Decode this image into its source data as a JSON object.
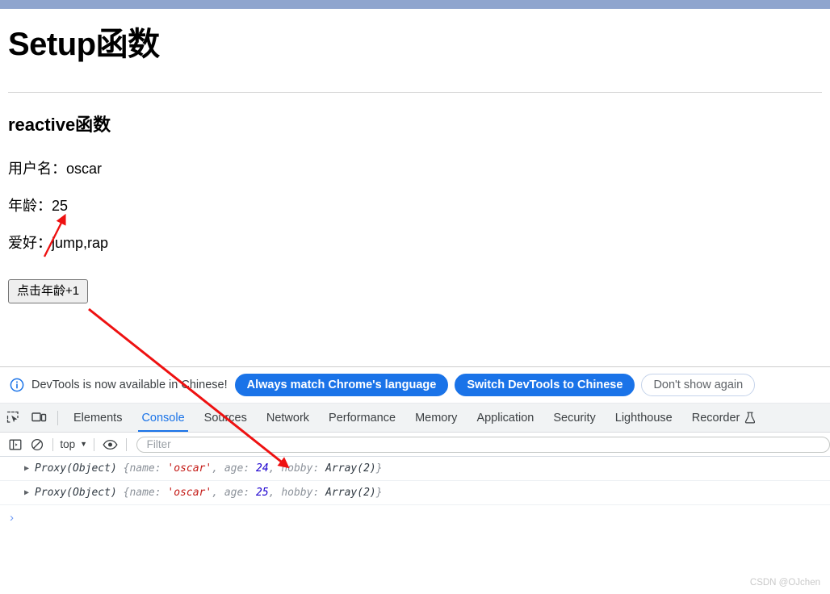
{
  "page": {
    "title": "Setup函数",
    "subtitle": "reactive函数",
    "fields": [
      {
        "label": "用户名：",
        "value": "oscar",
        "text": "用户名：oscar"
      },
      {
        "label": "年龄：",
        "value": "25",
        "text": "年龄：25"
      },
      {
        "label": "爱好：",
        "value": "jump,rap",
        "text": "爱好：jump,rap"
      }
    ],
    "button_label": "点击年龄+1"
  },
  "devtools": {
    "banner": {
      "icon": "info-circle-icon",
      "message": "DevTools is now available in Chinese!",
      "primary_action": "Always match Chrome's language",
      "secondary_action": "Switch DevTools to Chinese",
      "dismiss_action": "Don't show again"
    },
    "toolbar_icons": {
      "inspect": "inspect-element-icon",
      "device": "device-toolbar-icon"
    },
    "tabs": [
      {
        "label": "Elements",
        "active": false
      },
      {
        "label": "Console",
        "active": true
      },
      {
        "label": "Sources",
        "active": false
      },
      {
        "label": "Network",
        "active": false
      },
      {
        "label": "Performance",
        "active": false
      },
      {
        "label": "Memory",
        "active": false
      },
      {
        "label": "Application",
        "active": false
      },
      {
        "label": "Security",
        "active": false
      },
      {
        "label": "Lighthouse",
        "active": false
      },
      {
        "label": "Recorder",
        "active": false,
        "badge": "flask-icon"
      }
    ],
    "console_toolbar": {
      "sidebar_icon": "console-sidebar-icon",
      "clear_icon": "clear-console-icon",
      "context": "top",
      "eye_icon": "live-expression-eye-icon",
      "filter_placeholder": "Filter",
      "filter_value": ""
    },
    "console_messages": [
      {
        "class_name": "Proxy(Object)",
        "open_brace": "{",
        "name_key": "name:",
        "name_value": "'oscar'",
        "comma1": ",",
        "age_key": "age:",
        "age_value": "24",
        "comma2": ",",
        "hobby_key": "hobby:",
        "hobby_value": "Array(2)",
        "close_brace": "}"
      },
      {
        "class_name": "Proxy(Object)",
        "open_brace": "{",
        "name_key": "name:",
        "name_value": "'oscar'",
        "comma1": ",",
        "age_key": "age:",
        "age_value": "25",
        "comma2": ",",
        "hobby_key": "hobby:",
        "hobby_value": "Array(2)",
        "close_brace": "}"
      }
    ],
    "prompt_symbol": "›"
  },
  "annotations": {
    "arrow_color": "#ee1111",
    "arrow_1": "points at 年龄 value 25",
    "arrow_2": "points at console age value 24"
  },
  "watermark": "CSDN @OJchen",
  "colors": {
    "accent_blue": "#1a73e8",
    "top_strip": "#8fa5ce",
    "string_red": "#c41a16",
    "number_blue": "#1c00cf",
    "annotation_red": "#ee1111"
  }
}
